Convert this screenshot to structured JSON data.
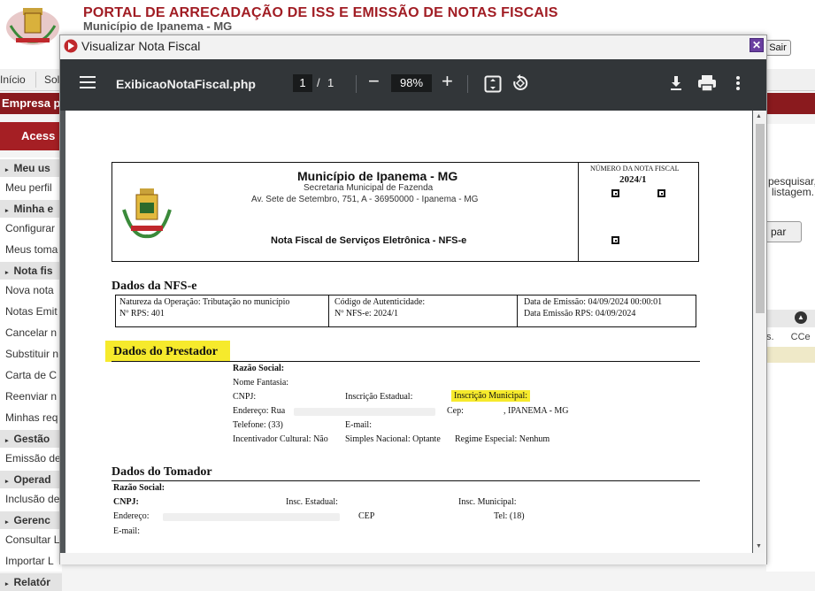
{
  "portal": {
    "title": "PORTAL DE ARRECADAÇÃO DE ISS E EMISSÃO DE NOTAS FISCAIS",
    "subtitle": "Município de Ipanema - MG",
    "logout_label": "Sair",
    "nav": [
      "Início",
      "Sol"
    ],
    "company_bar": "Empresa p",
    "access_button": "Acess",
    "right_text_1": "pesquisar,",
    "right_text_2": "listagem.",
    "right_button": "par",
    "right_col_1": "s.",
    "right_col_2": "CCe"
  },
  "sidebar": [
    {
      "type": "section",
      "label": "Meu us"
    },
    {
      "type": "link",
      "label": "Meu perfil"
    },
    {
      "type": "section",
      "label": "Minha e"
    },
    {
      "type": "link",
      "label": "Configurar"
    },
    {
      "type": "link",
      "label": "Meus toma"
    },
    {
      "type": "section",
      "label": "Nota fis"
    },
    {
      "type": "link",
      "label": "Nova nota"
    },
    {
      "type": "link",
      "label": "Notas Emit"
    },
    {
      "type": "link",
      "label": "Cancelar n"
    },
    {
      "type": "link",
      "label": "Substituir n"
    },
    {
      "type": "link",
      "label": "Carta de C"
    },
    {
      "type": "link",
      "label": "Reenviar n"
    },
    {
      "type": "link",
      "label": "Minhas req"
    },
    {
      "type": "section",
      "label": "Gestão"
    },
    {
      "type": "link",
      "label": "Emissão de"
    },
    {
      "type": "section",
      "label": "Operad"
    },
    {
      "type": "link",
      "label": "Inclusão de"
    },
    {
      "type": "section",
      "label": "Gerenc"
    },
    {
      "type": "link",
      "label": "Consultar L"
    },
    {
      "type": "link",
      "label": "Importar L"
    },
    {
      "type": "section",
      "label": "Relatór"
    }
  ],
  "modal": {
    "title": "Visualizar Nota Fiscal",
    "close_symbol": "✕"
  },
  "viewer": {
    "filename": "ExibicaoNotaFiscal.php",
    "current_page": "1",
    "page_separator": "/",
    "total_pages": "1",
    "zoom": "98%",
    "zoom_out_symbol": "−",
    "zoom_in_symbol": "+"
  },
  "nfse": {
    "header": {
      "municipality": "Município de Ipanema - MG",
      "secretariat": "Secretaria Municipal de Fazenda",
      "address": "Av. Sete de Setembro, 751, A - 36950000 - Ipanema - MG",
      "doc_title": "Nota Fiscal de Serviços Eletrônica - NFS-e",
      "number_label": "NÚMERO DA NOTA FISCAL",
      "number_value": "2024/1"
    },
    "dados_nfse": {
      "heading": "Dados da NFS-e",
      "natureza": "Natureza da Operação: Tributação no município",
      "rps": "Nº RPS: 401",
      "codigo": "Código de Autenticidade:",
      "numero": "Nº NFS-e: 2024/1",
      "data_emissao": "Data de Emissão: 04/09/2024 00:00:01",
      "data_rps": "Data Emissão RPS: 04/09/2024"
    },
    "prestador": {
      "heading": "Dados do Prestador",
      "razao": "Razão Social:",
      "fantasia": "Nome Fantasia:",
      "cnpj": "CNPJ:",
      "insc_estadual": "Inscrição Estadual:",
      "insc_municipal": "Inscrição Municipal:",
      "endereco": "Endereço: Rua",
      "cep": "Cep:",
      "cidade": ", IPANEMA - MG",
      "telefone": "Telefone: (33)",
      "email": "E-mail:",
      "incentivador": "Incentivador Cultural: Não",
      "simples": "Simples Nacional: Optante",
      "regime": "Regime Especial: Nenhum"
    },
    "tomador": {
      "heading": "Dados do Tomador",
      "razao": "Razão Social:",
      "cnpj": "CNPJ:",
      "insc_estadual": "Insc. Estadual:",
      "insc_municipal": "Insc. Municipal:",
      "endereco": "Endereço:",
      "cep": "CEP",
      "tel": "Tel: (18)",
      "email": "E-mail:"
    }
  },
  "colors": {
    "brand_red": "#a11d24",
    "toolbar": "#323639",
    "highlight": "#f6ea2c"
  }
}
